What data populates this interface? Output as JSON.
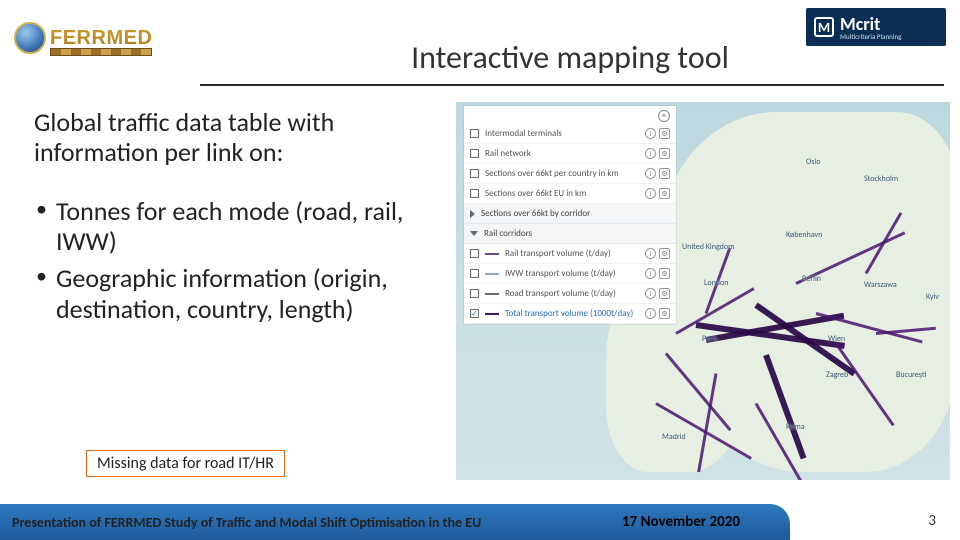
{
  "brand_left": "FERRMED",
  "brand_right": {
    "mark": "M",
    "name": "Mcrit",
    "tag": "Multicriteria Planning"
  },
  "title": "Interactive mapping tool",
  "lead": "Global traffic data table with information per link on:",
  "bullets": [
    "Tonnes for each mode (road, rail, IWW)",
    "Geographic information (origin, destination, country, length)"
  ],
  "note": "Missing data for road IT/HR",
  "layer_panel": {
    "rows_top": [
      {
        "label": "Intermodal terminals",
        "checked": false
      },
      {
        "label": "Rail network",
        "checked": false
      },
      {
        "label": "Sections over 66kt per country in km",
        "checked": false
      },
      {
        "label": "Sections over 66kt EU in km",
        "checked": false
      }
    ],
    "group1": "Sections over 66kt by corridor",
    "group2": "Rail corridors",
    "rows_vol": [
      {
        "label": "Rail transport volume (t/day)",
        "checked": false
      },
      {
        "label": "IWW transport volume (t/day)",
        "checked": false
      },
      {
        "label": "Road transport volume (t/day)",
        "checked": false
      },
      {
        "label": "Total transport volume (1000t/day)",
        "checked": true
      }
    ]
  },
  "map_cities": [
    "Oslo",
    "Stockholm",
    "København",
    "United Kingdom",
    "London",
    "Paris",
    "Madrid",
    "Berlin",
    "Warszawa",
    "Wien",
    "Roma",
    "Zagreb",
    "București",
    "Kyiv"
  ],
  "footer": {
    "text": "Presentation of FERRMED Study of Traffic and Modal Shift Optimisation in the EU",
    "date": "17 November 2020",
    "page": "3"
  }
}
